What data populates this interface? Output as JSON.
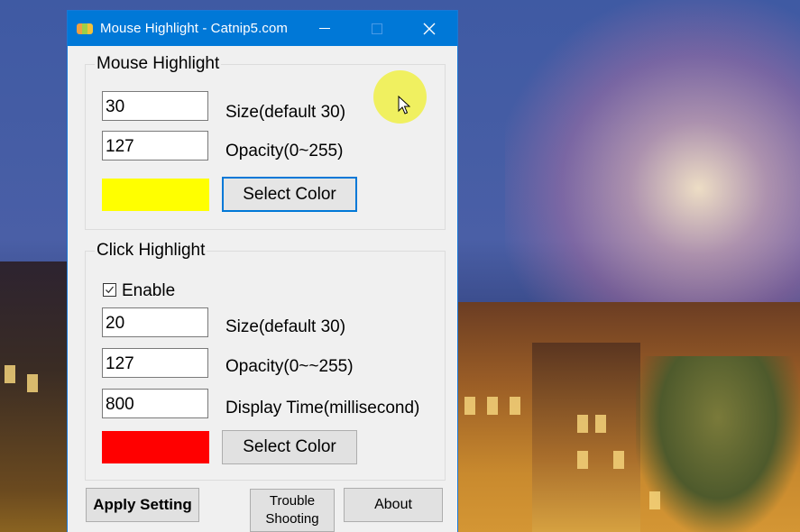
{
  "window": {
    "title": "Mouse Highlight - Catnip5.com",
    "accent_color": "#0078d7"
  },
  "mouse_highlight": {
    "legend": "Mouse Highlight",
    "size_value": "30",
    "size_label": "Size(default 30)",
    "opacity_value": "127",
    "opacity_label": "Opacity(0~255)",
    "color": "#ffff00",
    "select_color_label": "Select Color"
  },
  "click_highlight": {
    "legend": "Click Highlight",
    "enable_label": "Enable",
    "enable_checked": true,
    "size_value": "20",
    "size_label": "Size(default 30)",
    "opacity_value": "127",
    "opacity_label": "Opacity(0~~255)",
    "display_time_value": "800",
    "display_time_label": "Display Time(millisecond)",
    "color": "#ff0000",
    "select_color_label": "Select Color"
  },
  "footer": {
    "apply_label": "Apply Setting",
    "trouble_label_line1": "Trouble",
    "trouble_label_line2": "Shooting",
    "about_label": "About"
  }
}
